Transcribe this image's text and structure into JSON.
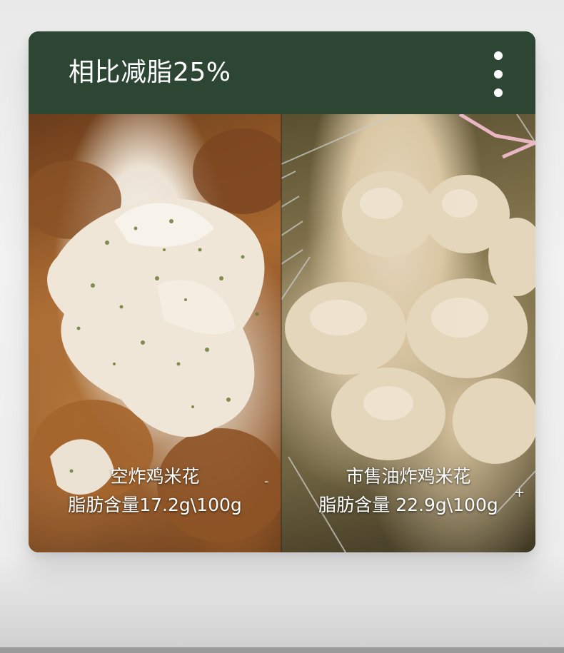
{
  "header": {
    "title": "相比减脂25%",
    "menu_icon": "more-vertical-icon"
  },
  "left_panel": {
    "line1": "空炸鸡米花",
    "line2": "脂肪含量17.2g\\100g",
    "corner_mark": "-"
  },
  "right_panel": {
    "line1": "市售油炸鸡米花",
    "line2": "脂肪含量 22.9g\\100g",
    "corner_mark": "+"
  },
  "colors": {
    "header_bg": "#2d4634",
    "text": "#ffffff"
  }
}
